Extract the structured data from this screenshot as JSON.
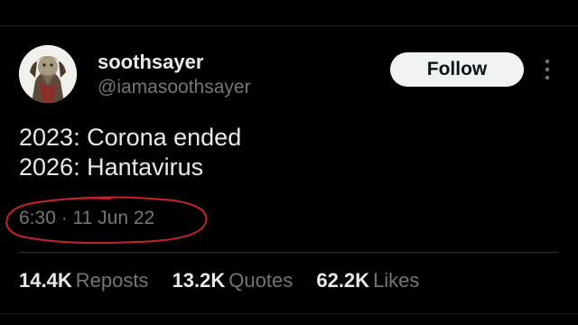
{
  "author": {
    "display_name": "soothsayer",
    "handle": "@iamasoothsayer",
    "avatar_icon": "soothsayer-avatar-icon"
  },
  "follow_label": "Follow",
  "more_icon": "more-options-icon",
  "tweet": {
    "lines": [
      "2023: Corona ended",
      "2026: Hantavirus"
    ],
    "timestamp": "6:30 · 11 Jun 22"
  },
  "stats": [
    {
      "value": "14.4K",
      "label": "Reposts"
    },
    {
      "value": "13.2K",
      "label": "Quotes"
    },
    {
      "value": "62.2K",
      "label": "Likes"
    }
  ],
  "colors": {
    "background": "#000000",
    "primary_text": "#e7e9ea",
    "secondary_text": "#71767b",
    "follow_bg": "#eff3f4",
    "annotation": "#c0262d"
  }
}
